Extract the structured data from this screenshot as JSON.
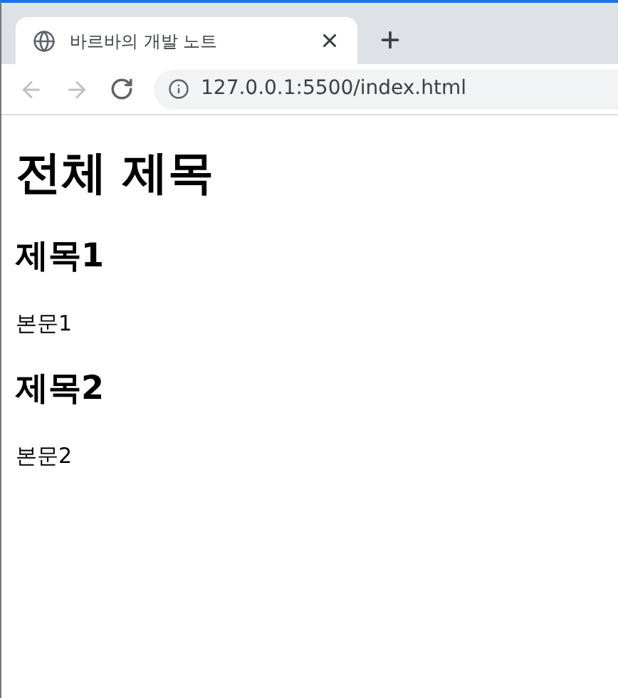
{
  "tab": {
    "title": "바르바의 개발 노트",
    "selected": true
  },
  "address_bar": {
    "url": "127.0.0.1:5500/index.html"
  },
  "page": {
    "title": "전체 제목",
    "sections": [
      {
        "heading": "제목1",
        "body": "본문1"
      },
      {
        "heading": "제목2",
        "body": "본문2"
      }
    ]
  }
}
